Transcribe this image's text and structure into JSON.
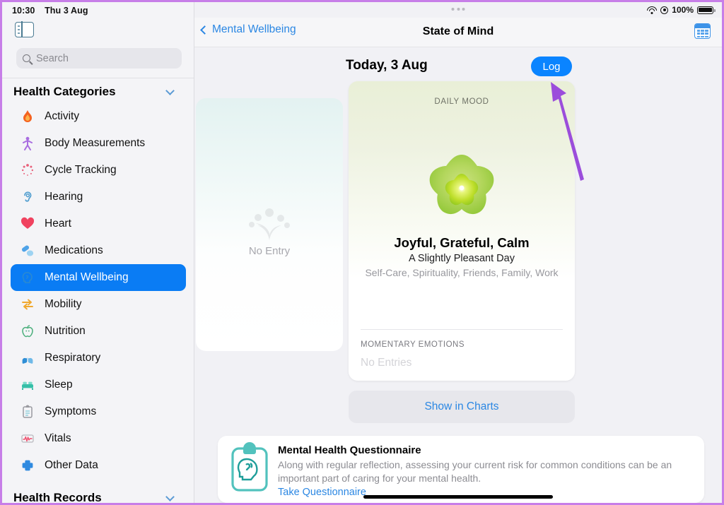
{
  "status_bar": {
    "time": "10:30",
    "date": "Thu 3 Aug",
    "battery_percent": "100%",
    "wifi_icon": "wifi-icon",
    "location_icon": "location-icon",
    "battery_icon": "battery-icon"
  },
  "sidebar": {
    "toggle_icon": "sidebar-toggle-icon",
    "search": {
      "placeholder": "Search",
      "value": "",
      "icon": "search-icon"
    },
    "sections": [
      {
        "title": "Health Categories",
        "expanded": true
      },
      {
        "title": "Health Records",
        "expanded": true
      }
    ],
    "items": [
      {
        "label": "Activity",
        "icon": "flame-icon",
        "selected": false
      },
      {
        "label": "Body Measurements",
        "icon": "body-icon",
        "selected": false
      },
      {
        "label": "Cycle Tracking",
        "icon": "cycle-icon",
        "selected": false
      },
      {
        "label": "Hearing",
        "icon": "ear-icon",
        "selected": false
      },
      {
        "label": "Heart",
        "icon": "heart-icon",
        "selected": false
      },
      {
        "label": "Medications",
        "icon": "pills-icon",
        "selected": false
      },
      {
        "label": "Mental Wellbeing",
        "icon": "brain-head-icon",
        "selected": true
      },
      {
        "label": "Mobility",
        "icon": "arrows-icon",
        "selected": false
      },
      {
        "label": "Nutrition",
        "icon": "apple-icon",
        "selected": false
      },
      {
        "label": "Respiratory",
        "icon": "lungs-icon",
        "selected": false
      },
      {
        "label": "Sleep",
        "icon": "bed-icon",
        "selected": false
      },
      {
        "label": "Symptoms",
        "icon": "clipboard-icon",
        "selected": false
      },
      {
        "label": "Vitals",
        "icon": "waveform-icon",
        "selected": false
      },
      {
        "label": "Other Data",
        "icon": "cross-icon",
        "selected": false
      }
    ]
  },
  "navbar": {
    "back_label": "Mental Wellbeing",
    "back_icon": "chevron-left-icon",
    "title": "State of Mind",
    "calendar_icon": "calendar-icon"
  },
  "day_header": {
    "title": "Today, 3 Aug",
    "log_button": "Log"
  },
  "empty_card": {
    "label": "No Entry",
    "icon": "mood-flower-outline-icon"
  },
  "mood_card": {
    "kicker": "DAILY MOOD",
    "flower_icon": "mood-flower-icon",
    "title": "Joyful, Grateful, Calm",
    "subtitle": "A Slightly Pleasant Day",
    "associations": "Self-Care, Spirituality, Friends, Family, Work",
    "momentary_kicker": "MOMENTARY EMOTIONS",
    "momentary_value": "No Entries"
  },
  "charts_button": {
    "label": "Show in Charts"
  },
  "questionnaire": {
    "icon": "clipboard-head-icon",
    "title": "Mental Health Questionnaire",
    "body": "Along with regular reflection, assessing your current risk for common conditions can be an important part of caring for your mental health.",
    "link": "Take Questionnaire"
  },
  "annotation": {
    "arrow_color": "#9b4ddb",
    "arrow_icon": "pointer-arrow-icon"
  },
  "colors": {
    "accent_blue": "#0a84ff",
    "link_blue": "#2b87e3",
    "selected_row": "#0a7cf4",
    "mood_green": "#9ccd3a",
    "card_bg": "#ffffff",
    "page_bg": "#f1f1f5",
    "sidebar_bg": "#f4f4f7",
    "annotation_purple": "#9b4ddb"
  }
}
